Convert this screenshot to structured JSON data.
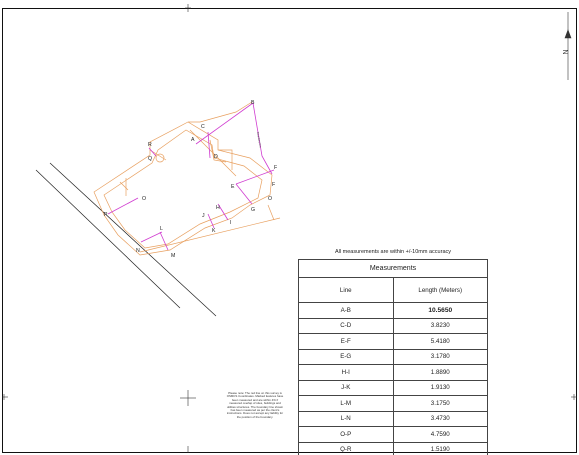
{
  "plan": {
    "north_label": "N",
    "points": [
      "A",
      "B",
      "C",
      "D",
      "E",
      "F",
      "G",
      "H",
      "I",
      "J",
      "K",
      "L",
      "M",
      "N",
      "O",
      "P",
      "Q",
      "R"
    ],
    "colors": {
      "measure_lines": "#d03cd0",
      "building_outline": "#e8a060",
      "road": "#222222",
      "frame": "#111111"
    }
  },
  "note": {
    "accuracy": "All measurements are within +/-10mm accuracy",
    "disclaimer": "Please note: The red line on this survey is OSMCS Coordinates. Marked features have been measured and are within 4% if measured overlap of sites, buildings and utilities structures. The boundary line shown has been measured as per the client's instructions. Does not accept any liability for the position of the boundary."
  },
  "table": {
    "title": "Measurements",
    "columns": [
      "Line",
      "Length (Meters)"
    ],
    "rows": [
      {
        "line": "A-B",
        "length": "10.5650"
      },
      {
        "line": "C-D",
        "length": "3.8230"
      },
      {
        "line": "E-F",
        "length": "5.4180"
      },
      {
        "line": "E-G",
        "length": "3.1780"
      },
      {
        "line": "H-I",
        "length": "1.8890"
      },
      {
        "line": "J-K",
        "length": "1.9130"
      },
      {
        "line": "L-M",
        "length": "3.1750"
      },
      {
        "line": "L-N",
        "length": "3.4730"
      },
      {
        "line": "O-P",
        "length": "4.7590"
      },
      {
        "line": "Q-R",
        "length": "1.5190"
      }
    ]
  }
}
